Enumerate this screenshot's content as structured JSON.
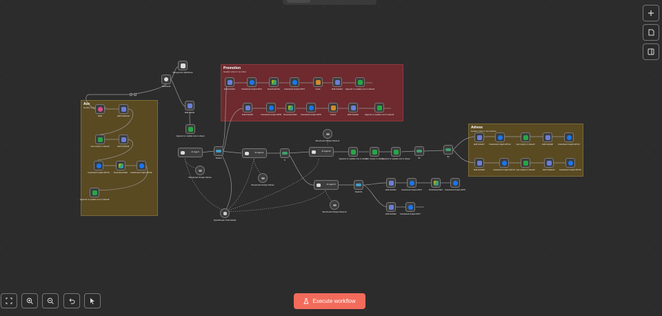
{
  "toolbar": {
    "execute_label": "Execute workflow"
  },
  "side_controls": [
    "plus-icon",
    "sticky-note-icon",
    "panel-toggle-icon"
  ],
  "bottom_controls": [
    "fit-view-icon",
    "zoom-in-icon",
    "zoom-out-icon",
    "undo-icon",
    "pointer-icon"
  ],
  "colors": {
    "accent": "#f26b5b",
    "canvas_bg": "#2c2c2c",
    "sticky_yellow": "#5a4a22",
    "sticky_red": "#6e2a2e",
    "node_border": "#7a7a7a"
  },
  "groups": {
    "ads": {
      "title": "Ads",
      "sub": "Header when in text Ads"
    },
    "promotion": {
      "title": "Promotion",
      "sub": "Header when in text #ad"
    },
    "adress": {
      "title": "Adress",
      "sub": "Header when in text adress"
    }
  },
  "nodes": {
    "webhook": "Webhook",
    "respond": "Respond to Webhook",
    "edit_fields_top": "Edit Fields",
    "append_sheet_top": "Append or update row in sheet",
    "ai_agent_1": "AI Agent",
    "switch_1": "Switch",
    "struct_parser_1": "Structured Output Parser",
    "ai_agent_2": "AI Agent1",
    "struct_parser_2": "Structured Output Parser",
    "if_1": "If",
    "ai_agent_3": "AI Agent2",
    "struct_parser_3": "Structured Output Parser1",
    "openrouter": "OpenRouter Chat Model",
    "get_rows_1": "Append or update row in sheet",
    "get_rows_2": "Get row(s) in sheet",
    "get_rows_3": "Append or update row in sheet",
    "if_2": "If1",
    "if_3": "If2",
    "ai_agent_4": "AI Agent3",
    "switch_2": "Switch1",
    "struct_parser_4": "Structured Output Parser2",
    "edit_fields_a": "Edit Fields1",
    "fb_graph_a": "Facebook Graph API4",
    "download_a": "Download file3",
    "fb_graph_b": "Facebook Graph API5",
    "edit_fields_b": "Edit Fields2",
    "fb_graph_c": "Facebook Graph API7",
    "ads_web": "Wait",
    "ads_edit1": "Edit Fields10",
    "ads_sheet1": "Get row(s) in sheet2",
    "ads_edit2": "Edit Fields11",
    "ads_fb1": "Facebook Graph API10",
    "ads_dl": "Download file6",
    "ads_fb2": "Facebook Graph API11",
    "ads_sheet2": "Append or update row in sheet3",
    "promo_edit1": "Edit Fields3",
    "promo_fb1": "Facebook Graph API2",
    "promo_dl1": "Download file",
    "promo_fb2": "Facebook Graph API3",
    "promo_code1": "Code",
    "promo_edit2": "Edit Fields4",
    "promo_sheet1": "Append or update row in sheet1",
    "promo_edit3": "Edit Fields5",
    "promo_fb3": "Facebook Graph API8",
    "promo_dl2": "Download file1",
    "promo_fb4": "Facebook Graph API9",
    "promo_code2": "Code1",
    "promo_edit4": "Edit Fields6",
    "promo_sheet2": "Append or update row in sheet2",
    "adr_edit1": "Edit Fields7",
    "adr_fb1": "Facebook Graph API12",
    "adr_sheet1": "Get row(s) in sheet3",
    "adr_edit2": "Edit Fields8",
    "adr_fb2": "Facebook Graph API13",
    "adr_edit3": "Edit Fields9",
    "adr_fb3": "Facebook Graph API14",
    "adr_sheet2": "Get row(s) in sheet4",
    "adr_edit4": "Edit Fields12",
    "adr_fb4": "Facebook Graph API15"
  }
}
